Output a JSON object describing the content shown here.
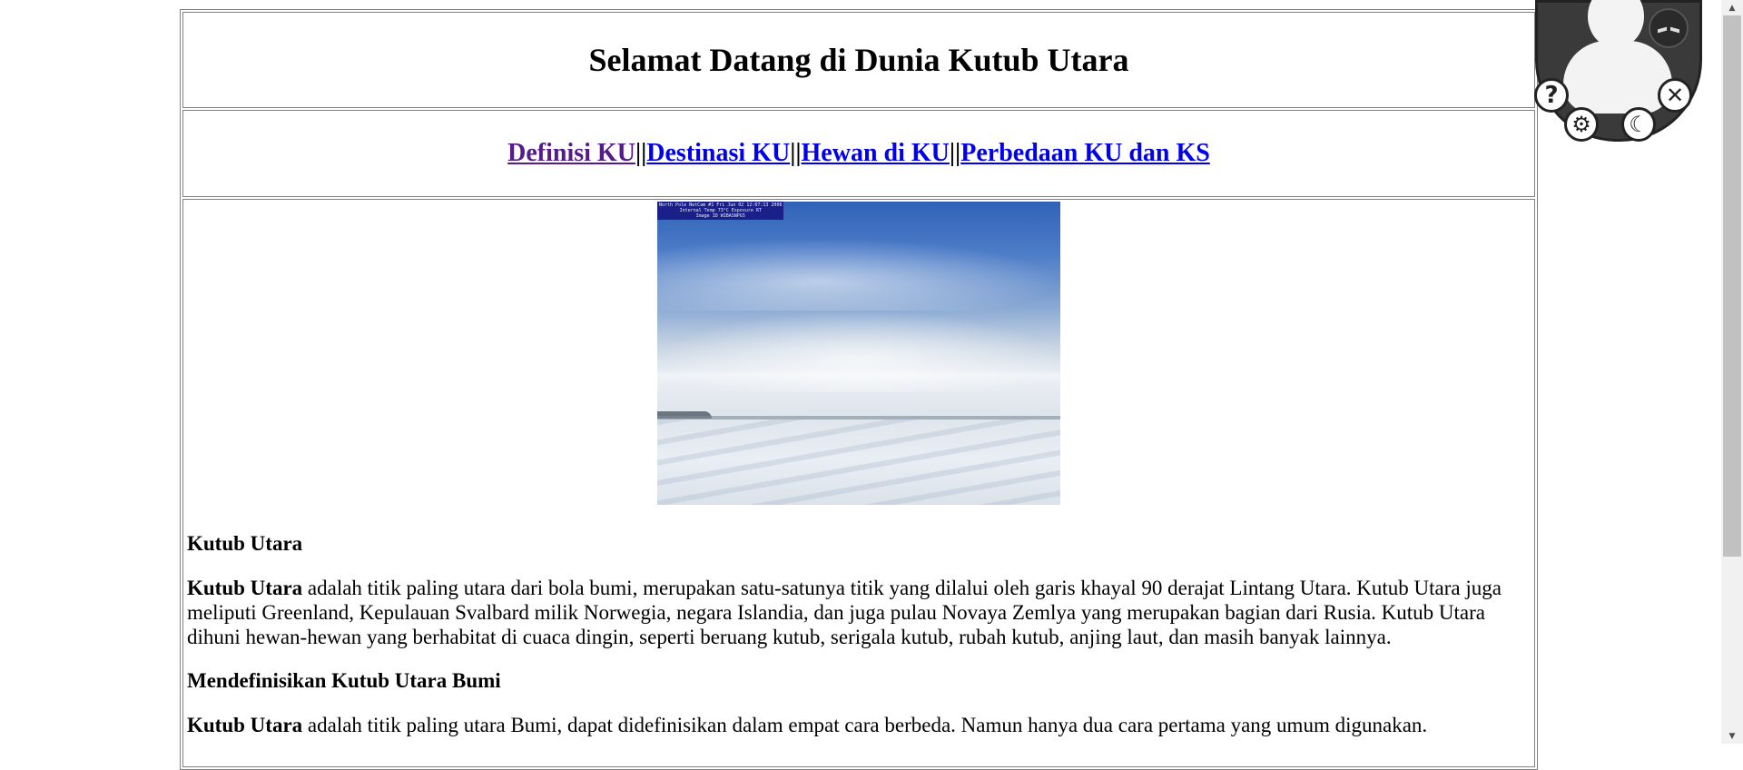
{
  "header": {
    "title": "Selamat Datang di Dunia Kutub Utara"
  },
  "nav": {
    "items": [
      {
        "label": "Definisi KU",
        "visited": true
      },
      {
        "label": "Destinasi KU",
        "visited": false
      },
      {
        "label": "Hewan di KU",
        "visited": false
      },
      {
        "label": "Perbedaan KU dan KS",
        "visited": false
      }
    ],
    "separator": "||"
  },
  "image": {
    "stamp": "North Pole NetCam #1 Fri Jun 02 12:07:13 2006\nInternal Temp 73°C Exposure RT\nImage ID WIBASNPG5"
  },
  "main": {
    "heading": "Kutub Utara",
    "para1_bold": "Kutub Utara",
    "para1_text": " adalah titik paling utara dari bola bumi, merupakan satu-satunya titik yang dilalui oleh garis khayal 90 derajat Lintang Utara. Kutub Utara juga meliputi Greenland, Kepulauan Svalbard milik Norwegia, negara Islandia, dan juga pulau Novaya Zemlya yang merupakan bagian dari Rusia. Kutub Utara dihuni hewan-hewan yang berhabitat di cuaca dingin, seperti beruang kutub, serigala kutub, rubah kutub, anjing laut, dan masih banyak lainnya.",
    "subheading": "Mendefinisikan Kutub Utara Bumi",
    "para2_bold": "Kutub Utara",
    "para2_text": " adalah titik paling utara Bumi, dapat didefinisikan dalam empat cara berbeda. Namun hanya dua cara pertama yang umum digunakan."
  },
  "widget": {
    "help": "?",
    "close": "✕",
    "settings": "⚙",
    "dark_mode": "☾"
  },
  "scrollbar": {
    "up": "▲",
    "down": "▼"
  }
}
